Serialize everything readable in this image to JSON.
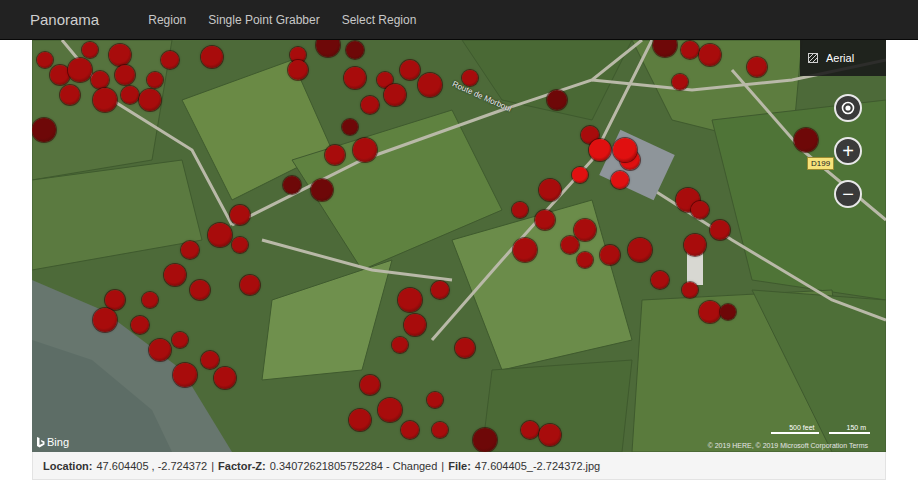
{
  "app": {
    "brand": "Panorama",
    "nav": [
      {
        "label": "Region",
        "selected": false
      },
      {
        "label": "Single Point Grabber",
        "selected": false
      },
      {
        "label": "Select Region",
        "selected": false
      }
    ]
  },
  "map": {
    "type_button": "Aerial",
    "controls": [
      "+",
      "−"
    ],
    "road_label": "Route de Morboul",
    "road_badge": "D199",
    "logo": "Bing",
    "scale": [
      "500 feet",
      "150 m"
    ],
    "copyright": "© 2019 HERE, © 2019 Microsoft Corporation Terms",
    "markers": [
      {
        "color": "#a80c0c"
      },
      {
        "color": "#a80c0c"
      },
      {
        "color": "#a80c0c"
      },
      {
        "color": "#a80c0c"
      },
      {
        "color": "#a80c0c"
      },
      {
        "color": "#a80c0c"
      },
      {
        "color": "#a80c0c"
      },
      {
        "color": "#a80c0c"
      },
      {
        "color": "#a80c0c"
      },
      {
        "color": "#a80c0c"
      },
      {
        "color": "#a80c0c"
      },
      {
        "color": "#a80c0c"
      },
      {
        "color": "#6e0808"
      },
      {
        "color": "#a80c0c"
      },
      {
        "color": "#a80c0c"
      },
      {
        "color": "#a80c0c"
      },
      {
        "color": "#a80c0c"
      },
      {
        "color": "#6e0808"
      },
      {
        "color": "#6e0808"
      },
      {
        "color": "#a80c0c"
      },
      {
        "color": "#a80c0c"
      },
      {
        "color": "#a80c0c"
      },
      {
        "color": "#a80c0c"
      },
      {
        "color": "#a80c0c"
      },
      {
        "color": "#a80c0c"
      },
      {
        "color": "#6e0808"
      },
      {
        "color": "#a80c0c"
      },
      {
        "color": "#a80c0c"
      },
      {
        "color": "#6e0808"
      },
      {
        "color": "#6e0808"
      },
      {
        "color": "#a80c0c"
      },
      {
        "color": "#6e0808"
      },
      {
        "color": "#6e0808"
      },
      {
        "color": "#a80c0c"
      },
      {
        "color": "#a80c0c"
      },
      {
        "color": "#a80c0c"
      },
      {
        "color": "#a80c0c"
      },
      {
        "color": "#6e0808"
      },
      {
        "color": "#a80c0c"
      },
      {
        "color": "#e01010"
      },
      {
        "color": "#e01010"
      },
      {
        "color": "#e01010"
      },
      {
        "color": "#e01010"
      },
      {
        "color": "#e01010"
      },
      {
        "color": "#a80c0c"
      },
      {
        "color": "#a80c0c"
      },
      {
        "color": "#a80c0c"
      },
      {
        "color": "#a80c0c"
      },
      {
        "color": "#a80c0c"
      },
      {
        "color": "#a80c0c"
      },
      {
        "color": "#a80c0c"
      },
      {
        "color": "#a80c0c"
      },
      {
        "color": "#a80c0c"
      },
      {
        "color": "#a80c0c"
      },
      {
        "color": "#a80c0c"
      },
      {
        "color": "#a80c0c"
      },
      {
        "color": "#a80c0c"
      },
      {
        "color": "#a80c0c"
      },
      {
        "color": "#a80c0c"
      },
      {
        "color": "#a80c0c"
      },
      {
        "color": "#6e0808"
      },
      {
        "color": "#a80c0c"
      },
      {
        "color": "#a80c0c"
      },
      {
        "color": "#a80c0c"
      },
      {
        "color": "#a80c0c"
      },
      {
        "color": "#a80c0c"
      },
      {
        "color": "#a80c0c"
      },
      {
        "color": "#a80c0c"
      },
      {
        "color": "#a80c0c"
      },
      {
        "color": "#a80c0c"
      },
      {
        "color": "#a80c0c"
      },
      {
        "color": "#a80c0c"
      },
      {
        "color": "#a80c0c"
      },
      {
        "color": "#a80c0c"
      },
      {
        "color": "#a80c0c"
      },
      {
        "color": "#a80c0c"
      },
      {
        "color": "#a80c0c"
      },
      {
        "color": "#a80c0c"
      },
      {
        "color": "#a80c0c"
      },
      {
        "color": "#a80c0c"
      },
      {
        "color": "#a80c0c"
      },
      {
        "color": "#a80c0c"
      },
      {
        "color": "#a80c0c"
      },
      {
        "color": "#a80c0c"
      },
      {
        "color": "#a80c0c"
      },
      {
        "color": "#a80c0c"
      },
      {
        "color": "#a80c0c"
      },
      {
        "color": "#6e0808"
      },
      {
        "color": "#a80c0c"
      },
      {
        "color": "#a80c0c"
      },
      {
        "color": "#a80c0c"
      }
    ]
  },
  "info": {
    "separator": "|",
    "items": [
      {
        "label": "Location:",
        "value": "47.604405 , -2.724372"
      },
      {
        "label": "Factor-Z:",
        "value": "0.34072621805752284 - Changed"
      },
      {
        "label": "File:",
        "value": "47.604405_-2.724372.jpg"
      }
    ]
  }
}
